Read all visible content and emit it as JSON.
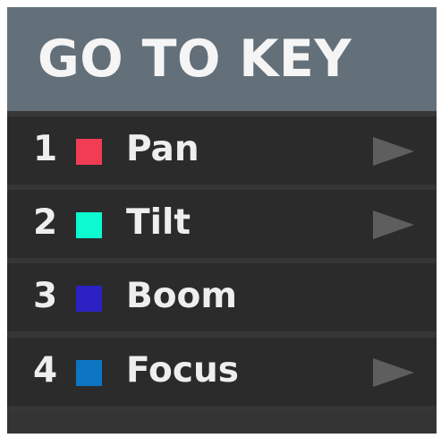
{
  "header": {
    "title": "GO TO KEY"
  },
  "items": [
    {
      "number": "1",
      "label": "Pan",
      "color": "#f13c56",
      "has_arrow": true,
      "arrow_icon": "play-arrow-icon"
    },
    {
      "number": "2",
      "label": "Tilt",
      "color": "#0df9d0",
      "has_arrow": true,
      "arrow_icon": "play-arrow-icon"
    },
    {
      "number": "3",
      "label": "Boom",
      "color": "#2b21c3",
      "has_arrow": false
    },
    {
      "number": "4",
      "label": "Focus",
      "color": "#0d76c4",
      "has_arrow": true,
      "arrow_icon": "play-arrow-icon"
    }
  ],
  "colors": {
    "header_bg": "#637079",
    "row_bg": "#2b2b2b",
    "panel_bg": "#363636",
    "text": "#eeeeee",
    "arrow": "#5e5e5e"
  }
}
